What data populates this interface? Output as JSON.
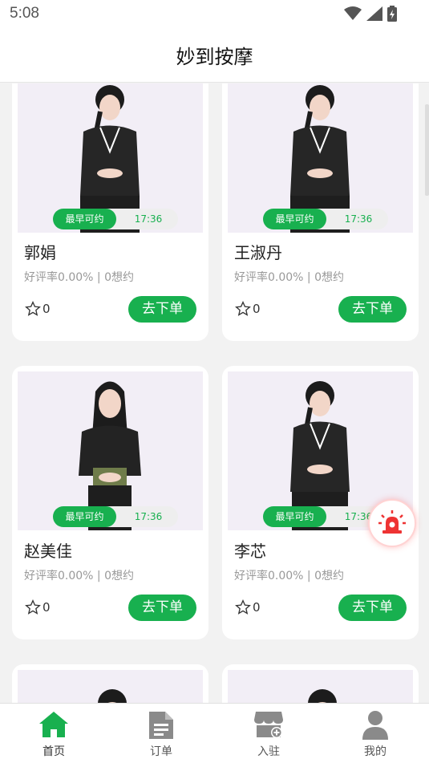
{
  "status": {
    "time": "5:08"
  },
  "header": {
    "title": "妙到按摩"
  },
  "availability_label": "最早可约",
  "order_label": "去下单",
  "cards": [
    {
      "name": "郭娟",
      "rating": "好评率0.00% | 0想约",
      "time": "17:36",
      "stars": "0"
    },
    {
      "name": "王淑丹",
      "rating": "好评率0.00% | 0想约",
      "time": "17:36",
      "stars": "0"
    },
    {
      "name": "赵美佳",
      "rating": "好评率0.00% | 0想约",
      "time": "17:36",
      "stars": "0"
    },
    {
      "name": "李芯",
      "rating": "好评率0.00% | 0想约",
      "time": "17:36",
      "stars": "0"
    }
  ],
  "tabs": [
    {
      "label": "首页",
      "icon": "home-icon",
      "active": true
    },
    {
      "label": "订单",
      "icon": "document-icon",
      "active": false
    },
    {
      "label": "入驻",
      "icon": "store-icon",
      "active": false
    },
    {
      "label": "我的",
      "icon": "user-icon",
      "active": false
    }
  ],
  "colors": {
    "accent": "#18b04f",
    "alarm": "#ee3333"
  }
}
